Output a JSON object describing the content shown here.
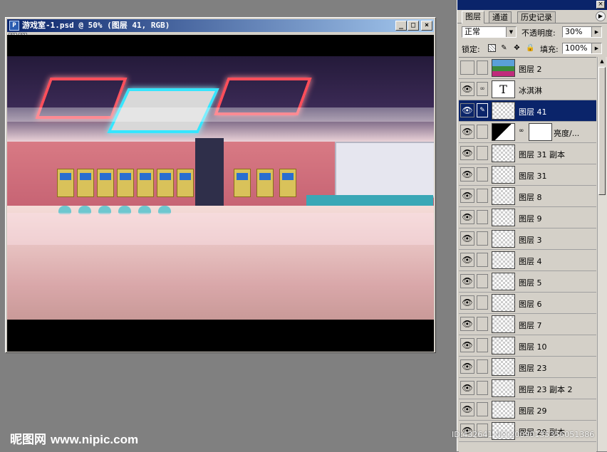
{
  "document": {
    "title": "游戏室-1.psd @ 50% (图层 41, RGB)",
    "toolbar_buttons": [
      "01",
      "02"
    ]
  },
  "layers_panel": {
    "tabs": [
      "图层",
      "通道",
      "历史记录"
    ],
    "active_tab": "图层",
    "blend_mode": "正常",
    "opacity_label": "不透明度:",
    "opacity_value": "30%",
    "lock_label": "锁定:",
    "fill_label": "填充:",
    "fill_value": "100%",
    "layers": [
      {
        "name": "图层 2",
        "visible": false,
        "thumb": "image"
      },
      {
        "name": "冰淇淋",
        "visible": true,
        "thumb": "text",
        "thumb_text": "T"
      },
      {
        "name": "图层 41",
        "visible": true,
        "thumb": "transparent",
        "selected": true
      },
      {
        "name": "亮度/...",
        "visible": true,
        "thumb": "adjust"
      },
      {
        "name": "图层 31 副本",
        "visible": true,
        "thumb": "transparent"
      },
      {
        "name": "图层 31",
        "visible": true,
        "thumb": "transparent"
      },
      {
        "name": "图层 8",
        "visible": true,
        "thumb": "transparent"
      },
      {
        "name": "图层 9",
        "visible": true,
        "thumb": "transparent"
      },
      {
        "name": "图层 3",
        "visible": true,
        "thumb": "transparent"
      },
      {
        "name": "图层 4",
        "visible": true,
        "thumb": "transparent"
      },
      {
        "name": "图层 5",
        "visible": true,
        "thumb": "transparent"
      },
      {
        "name": "图层 6",
        "visible": true,
        "thumb": "transparent"
      },
      {
        "name": "图层 7",
        "visible": true,
        "thumb": "transparent"
      },
      {
        "name": "图层 10",
        "visible": true,
        "thumb": "transparent"
      },
      {
        "name": "图层 23",
        "visible": true,
        "thumb": "transparent"
      },
      {
        "name": "图层 23 副本 2",
        "visible": true,
        "thumb": "transparent"
      },
      {
        "name": "图层 29",
        "visible": true,
        "thumb": "transparent"
      },
      {
        "name": "图层 29 副本",
        "visible": true,
        "thumb": "transparent"
      }
    ]
  },
  "watermark": {
    "logo": "昵图网",
    "url": "www.nipic.com",
    "id_text": "ID:432641 NO:20090135356051386"
  },
  "icons": {
    "eye": "eye-icon",
    "brush": "brush-icon",
    "link": "chain-link-icon"
  }
}
